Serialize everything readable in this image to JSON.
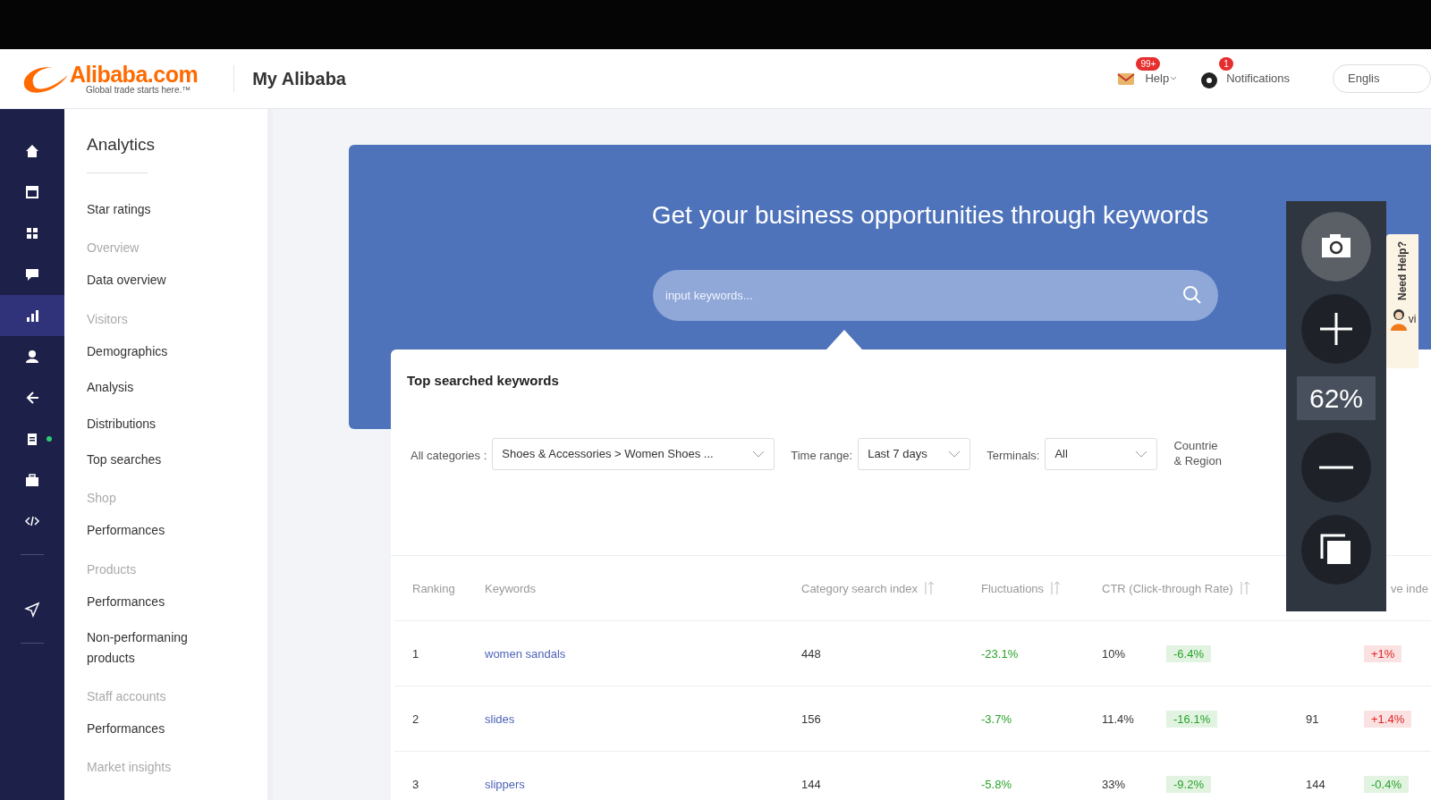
{
  "header": {
    "logo": {
      "wordmark": "Alibaba.com",
      "tagline": "Global trade starts here.™"
    },
    "title": "My Alibaba",
    "messages_badge": "99+",
    "help": "Help",
    "notifications_badge": "1",
    "notifications": "Notifications",
    "language": "Englis"
  },
  "rail": [
    {
      "kind": "home",
      "selected": false
    },
    {
      "kind": "window",
      "selected": false
    },
    {
      "kind": "grid",
      "selected": false
    },
    {
      "kind": "chat",
      "selected": false
    },
    {
      "kind": "chart",
      "selected": true
    },
    {
      "kind": "user",
      "selected": false
    },
    {
      "kind": "arrows",
      "selected": false
    },
    {
      "kind": "clipboard",
      "selected": false,
      "dot": true
    },
    {
      "kind": "briefcase",
      "selected": false
    },
    {
      "kind": "code",
      "selected": false
    },
    {
      "kind": "divider"
    },
    {
      "kind": "send",
      "selected": false
    },
    {
      "kind": "divider"
    }
  ],
  "sidebar": {
    "title": "Analytics",
    "items": [
      {
        "kind": "link",
        "label": "Star ratings"
      },
      {
        "kind": "heading",
        "label": "Overview"
      },
      {
        "kind": "link",
        "label": "Data overview"
      },
      {
        "kind": "heading",
        "label": "Visitors"
      },
      {
        "kind": "link",
        "label": "Demographics"
      },
      {
        "kind": "link",
        "label": "Analysis"
      },
      {
        "kind": "link",
        "label": "Distributions"
      },
      {
        "kind": "link",
        "label": "Top searches"
      },
      {
        "kind": "heading",
        "label": "Shop"
      },
      {
        "kind": "link",
        "label": "Performances"
      },
      {
        "kind": "heading",
        "label": "Products"
      },
      {
        "kind": "link",
        "label": "Performances"
      },
      {
        "kind": "link",
        "label": "Non-performaning products"
      },
      {
        "kind": "heading",
        "label": "Staff accounts"
      },
      {
        "kind": "link",
        "label": "Performances"
      },
      {
        "kind": "heading",
        "label": "Market insights"
      }
    ]
  },
  "banner": {
    "title": "Get your business opportunities through keywords",
    "search": {
      "placeholder": "input keywords..."
    }
  },
  "panel": {
    "title": "Top searched keywords",
    "filters": [
      {
        "label": "All categories :",
        "value": "Shoes & Accessories > Women Shoes ..."
      },
      {
        "label": "Time range:",
        "value": "Last 7 days"
      },
      {
        "label": "Terminals:",
        "value": "All"
      },
      {
        "label": "Countrie & Region"
      }
    ],
    "table": {
      "columns": [
        {
          "label": "Ranking",
          "sortable": false
        },
        {
          "label": "Keywords",
          "sortable": false
        },
        {
          "label": "Category search index",
          "sortable": true
        },
        {
          "label": "Fluctuations",
          "sortable": true
        },
        {
          "label": "CTR (Click-through Rate)",
          "sortable": true
        },
        {
          "label": "ve inde",
          "sortable": false
        }
      ],
      "rows": [
        {
          "ranking": "1",
          "keyword": "women sandals",
          "search_index": "448",
          "fluctuation": {
            "text": "-23.1%",
            "color": "#29a329"
          },
          "ctr": "10%",
          "ctr_change": {
            "text": "-6.4%",
            "color": "#29a329"
          },
          "column_8": {
            "text": "+1%",
            "color": "#e02424"
          }
        },
        {
          "ranking": "2",
          "keyword": "slides",
          "search_index": "156",
          "fluctuation": {
            "text": "-3.7%",
            "color": "#29a329"
          },
          "ctr": "11.4%",
          "ctr_change": {
            "text": "-16.1%",
            "color": "#29a329"
          },
          "column_7": "91",
          "column_8": {
            "text": "+1.4%",
            "color": "#e02424"
          }
        },
        {
          "ranking": "3",
          "keyword": "slippers",
          "search_index": "144",
          "fluctuation": {
            "text": "-5.8%",
            "color": "#29a329"
          },
          "ctr": "33%",
          "ctr_change": {
            "text": "-9.2%",
            "color": "#29a329"
          },
          "column_7": "144",
          "column_8": {
            "text": "-0.4%",
            "color": "#29a329"
          }
        }
      ]
    }
  },
  "help_tab": {
    "label": "Need Help?",
    "text": "vi"
  },
  "zoom_tool": {
    "zoom": "62%",
    "buttons": [
      {
        "kind": "camera",
        "selected": true
      },
      {
        "kind": "plus",
        "selected": false
      },
      {
        "kind": "minus",
        "selected": false
      },
      {
        "kind": "copy",
        "selected": false
      }
    ]
  }
}
